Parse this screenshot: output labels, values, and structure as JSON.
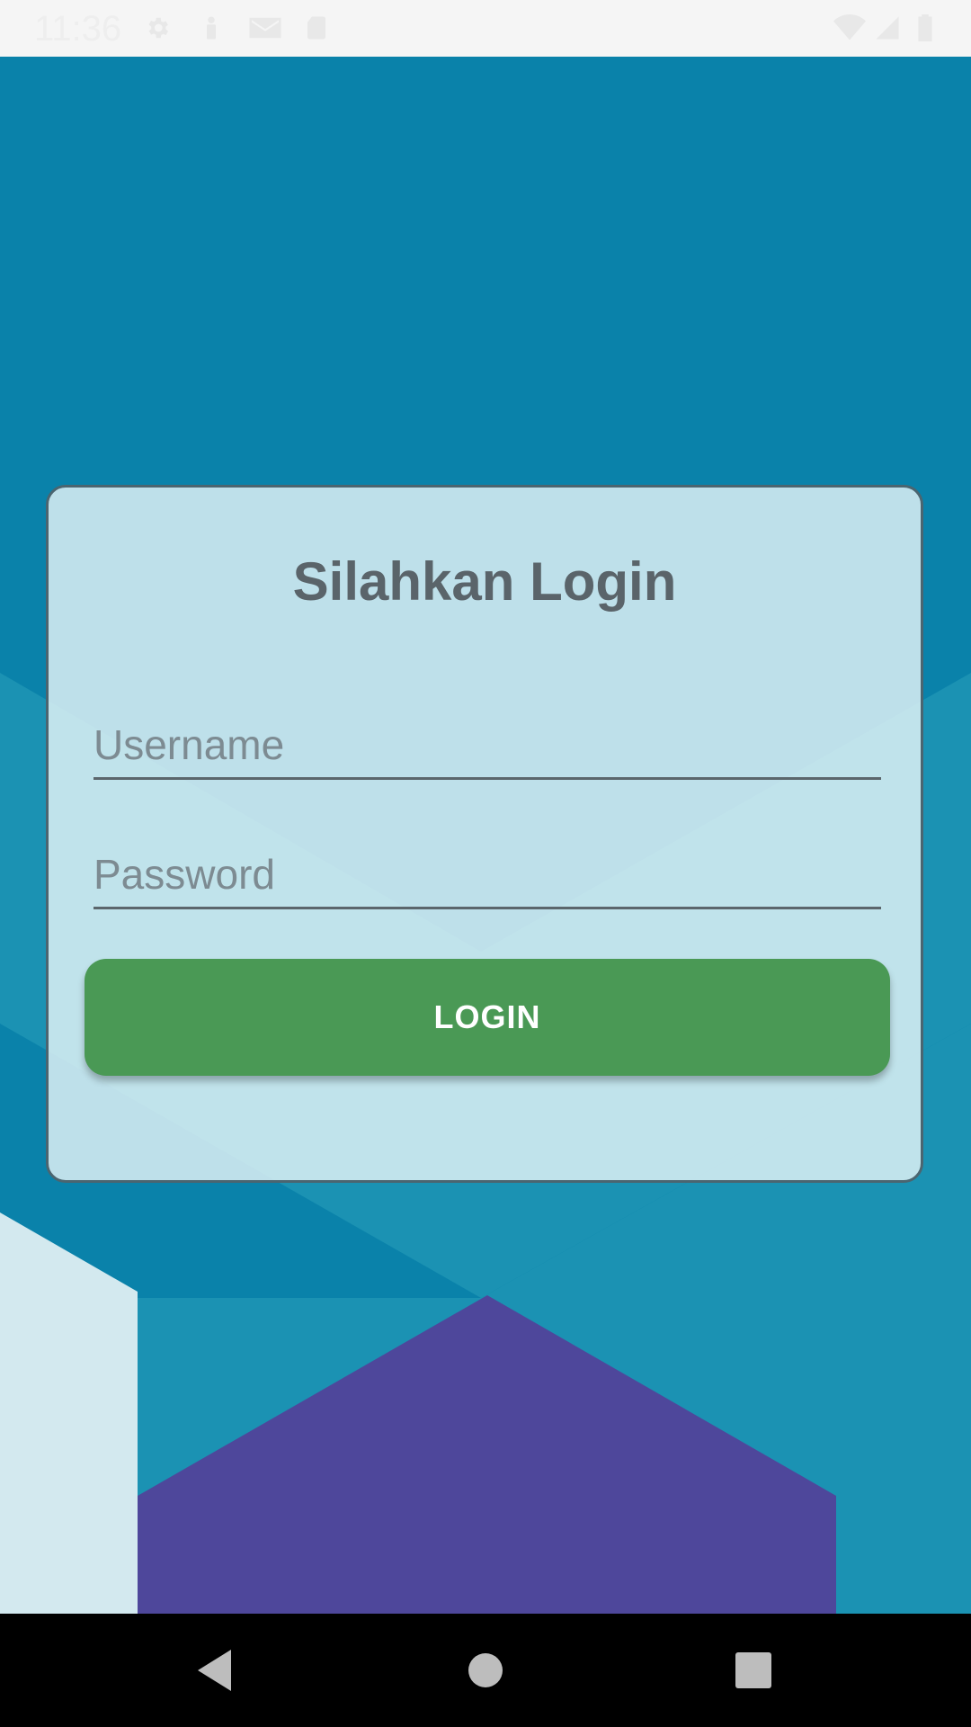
{
  "status_bar": {
    "time": "11:36",
    "left_icons": [
      "gear-icon",
      "person-icon",
      "gmail-icon",
      "sd-card-icon"
    ],
    "right_icons": [
      "wifi-icon",
      "signal-icon",
      "battery-icon"
    ]
  },
  "login_card": {
    "title": "Silahkan Login",
    "username_placeholder": "Username",
    "username_value": "",
    "password_placeholder": "Password",
    "password_value": "",
    "login_label": "LOGIN"
  },
  "nav_bar": {
    "buttons": [
      "back-icon",
      "home-icon",
      "recents-icon"
    ]
  },
  "colors": {
    "background_blue": "#0a82aa",
    "accent_teal": "#1b92b3",
    "hex_purple": "#4e479b",
    "button_green": "#4a9955",
    "title_gray": "#5a646a"
  }
}
